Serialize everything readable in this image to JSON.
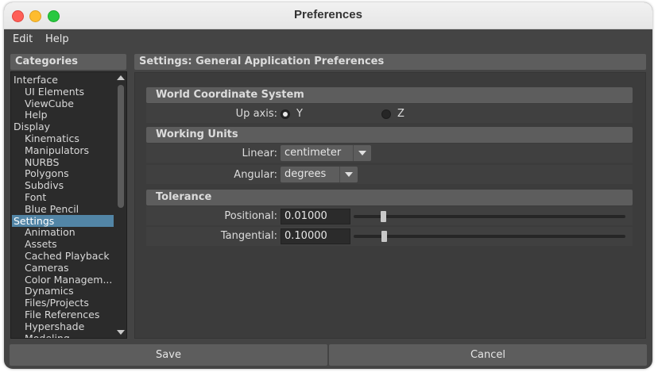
{
  "window": {
    "title": "Preferences"
  },
  "menu": {
    "edit": "Edit",
    "help": "Help"
  },
  "categories": {
    "header": "Categories",
    "items": [
      {
        "label": "Interface",
        "indent": 0,
        "selected": false
      },
      {
        "label": "UI Elements",
        "indent": 1,
        "selected": false
      },
      {
        "label": "ViewCube",
        "indent": 1,
        "selected": false
      },
      {
        "label": "Help",
        "indent": 1,
        "selected": false
      },
      {
        "label": "Display",
        "indent": 0,
        "selected": false
      },
      {
        "label": "Kinematics",
        "indent": 1,
        "selected": false
      },
      {
        "label": "Manipulators",
        "indent": 1,
        "selected": false
      },
      {
        "label": "NURBS",
        "indent": 1,
        "selected": false
      },
      {
        "label": "Polygons",
        "indent": 1,
        "selected": false
      },
      {
        "label": "Subdivs",
        "indent": 1,
        "selected": false
      },
      {
        "label": "Font",
        "indent": 1,
        "selected": false
      },
      {
        "label": "Blue Pencil",
        "indent": 1,
        "selected": false
      },
      {
        "label": "Settings",
        "indent": 0,
        "selected": true
      },
      {
        "label": "Animation",
        "indent": 1,
        "selected": false
      },
      {
        "label": "Assets",
        "indent": 1,
        "selected": false
      },
      {
        "label": "Cached Playback",
        "indent": 1,
        "selected": false
      },
      {
        "label": "Cameras",
        "indent": 1,
        "selected": false
      },
      {
        "label": "Color Managem...",
        "indent": 1,
        "selected": false
      },
      {
        "label": "Dynamics",
        "indent": 1,
        "selected": false
      },
      {
        "label": "Files/Projects",
        "indent": 1,
        "selected": false
      },
      {
        "label": "File References",
        "indent": 1,
        "selected": false
      },
      {
        "label": "Hypershade",
        "indent": 1,
        "selected": false
      },
      {
        "label": "Modeling",
        "indent": 1,
        "selected": false
      }
    ]
  },
  "settings": {
    "header": "Settings: General Application Preferences",
    "world": {
      "title": "World Coordinate System",
      "up_axis_label": "Up axis:",
      "option_y": "Y",
      "option_z": "Z",
      "selected": "Y"
    },
    "units": {
      "title": "Working Units",
      "linear_label": "Linear:",
      "linear_value": "centimeter",
      "angular_label": "Angular:",
      "angular_value": "degrees"
    },
    "tolerance": {
      "title": "Tolerance",
      "positional_label": "Positional:",
      "positional_value": "0.01000",
      "tangential_label": "Tangential:",
      "tangential_value": "0.10000"
    }
  },
  "buttons": {
    "save": "Save",
    "cancel": "Cancel"
  }
}
